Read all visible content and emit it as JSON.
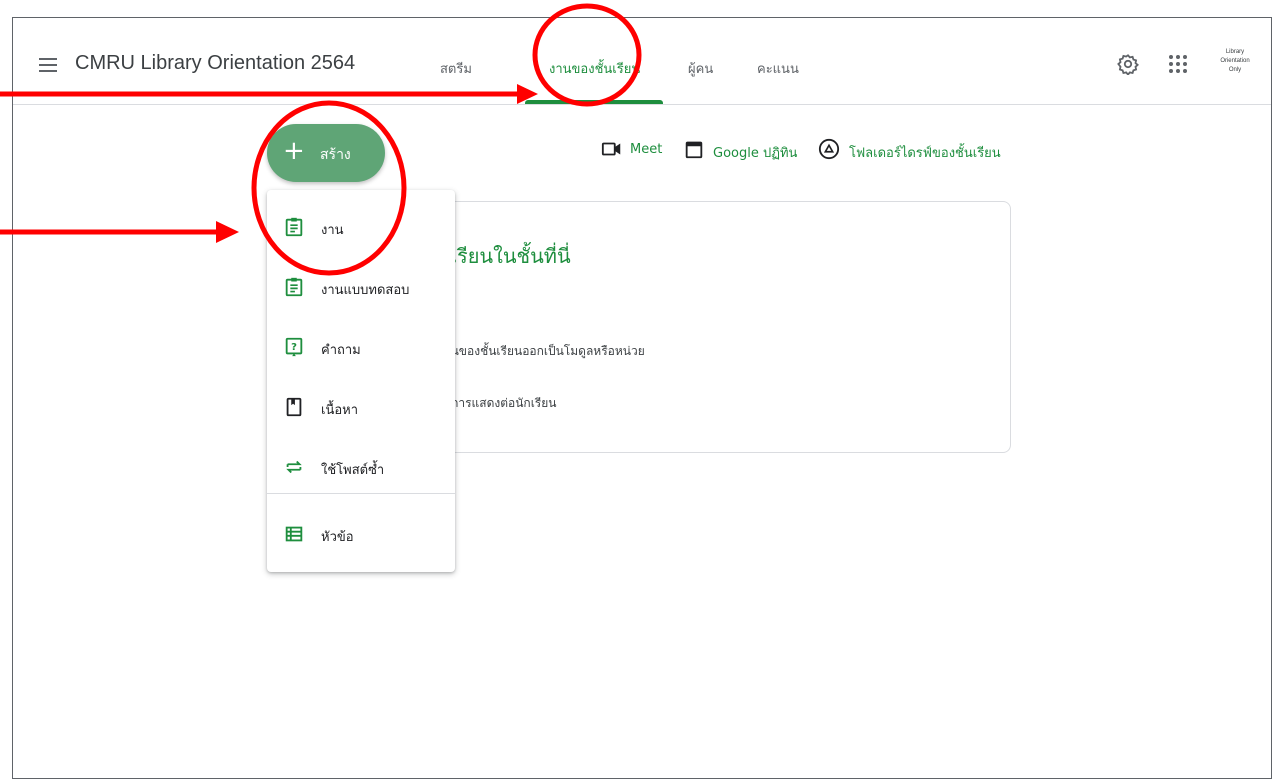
{
  "header": {
    "title": "CMRU Library Orientation 2564",
    "tabs": [
      {
        "label": "สตรีม"
      },
      {
        "label": "งานของชั้นเรียน"
      },
      {
        "label": "ผู้คน"
      },
      {
        "label": "คะแนน"
      }
    ],
    "avatar_text": [
      "Library",
      "Orientation",
      "Only"
    ]
  },
  "create_button": {
    "label": "สร้าง"
  },
  "toolbar": {
    "meet_label": "Meet",
    "calendar_label": "Google ปฏิทิน",
    "drive_label": "โฟลเดอร์ไดรฟ์ของชั้นเรียน"
  },
  "card": {
    "title": "กเรียนในชั้นที่นี่",
    "line1": "งานของชั้นเรียนออกเป็นโมดูลหรือหน่วย",
    "line2": "องการแสดงต่อนักเรียน"
  },
  "menu": {
    "items": [
      {
        "label": "งาน",
        "icon": "assignment-icon"
      },
      {
        "label": "งานแบบทดสอบ",
        "icon": "quiz-assignment-icon"
      },
      {
        "label": "คำถาม",
        "icon": "question-icon"
      },
      {
        "label": "เนื้อหา",
        "icon": "material-icon"
      },
      {
        "label": "ใช้โพสต์ซ้ำ",
        "icon": "reuse-post-icon"
      },
      {
        "label": "หัวข้อ",
        "icon": "topic-icon"
      }
    ]
  },
  "colors": {
    "accent": "#1e8e3e",
    "create_button": "#5fa576",
    "annotation": "#ff0000"
  }
}
